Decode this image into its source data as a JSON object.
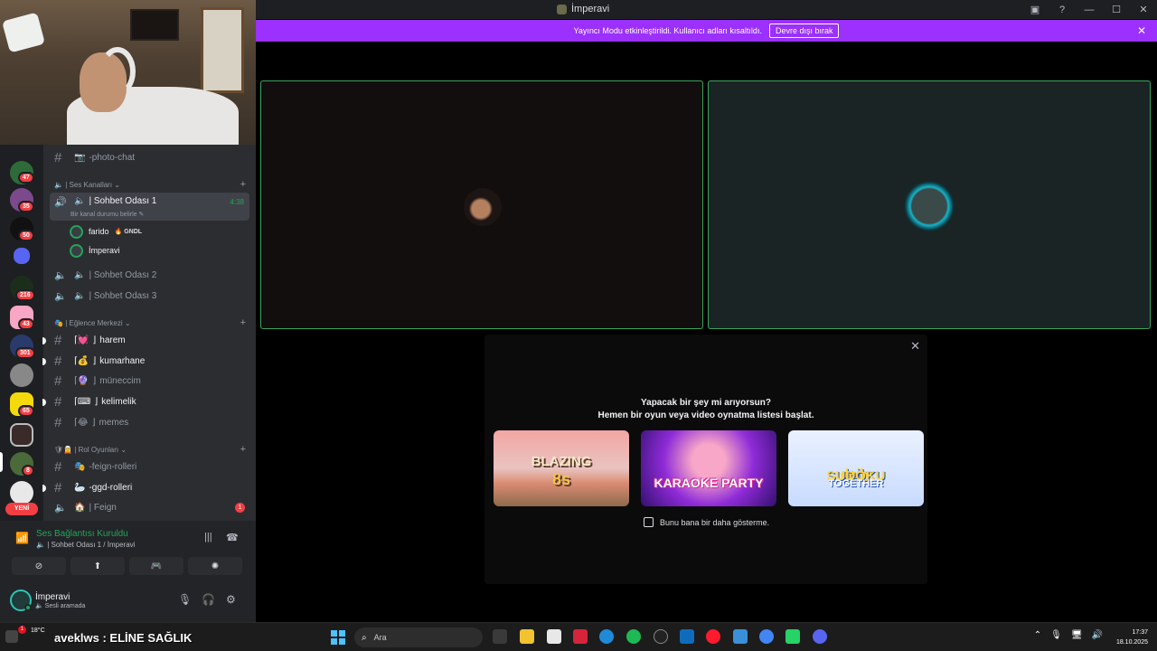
{
  "window": {
    "title": "İmperavi",
    "controls": [
      "minimize-icon",
      "maximize-icon",
      "close-icon"
    ]
  },
  "banner": {
    "message": "Yayıncı Modu etkinleştirildi. Kullanıcı adları kısaltıldı.",
    "button": "Devre dışı bırak",
    "close": "✕"
  },
  "guilds": {
    "badges": [
      "38",
      "47",
      "35",
      "50",
      "216",
      "43",
      "301",
      "65",
      "8"
    ],
    "new_label": "YENİ"
  },
  "channels": {
    "photo_chat": "-photo-chat",
    "voice_category": "| Ses Kanalları",
    "voice": [
      {
        "name": "| Sohbet Odası 1",
        "time": "4:38",
        "status_placeholder": "Bir kanal durumu belirle"
      },
      {
        "name": "| Sohbet Odası 2"
      },
      {
        "name": "| Sohbet Odası 3"
      }
    ],
    "voice_users": [
      {
        "name": "farido",
        "tag": "GNDL"
      },
      {
        "name": "İmperavi"
      }
    ],
    "fun_category": "| Eğlence Merkezi",
    "fun": [
      {
        "emoji": "💓",
        "name": "harem"
      },
      {
        "emoji": "💰",
        "name": "kumarhane"
      },
      {
        "emoji": "🔮",
        "name": "müneccim"
      },
      {
        "emoji": "⌨",
        "name": "kelimelik"
      },
      {
        "emoji": "😂",
        "name": "memes"
      }
    ],
    "bracket_open": "⌈",
    "bracket_close": "⌋",
    "rp_category": "| Rol Oyunları",
    "rp": [
      {
        "name": "-feign-rolleri"
      },
      {
        "name": "-ggd-rolleri"
      },
      {
        "name": "| Feign",
        "badge": "1"
      }
    ]
  },
  "voice_panel": {
    "status": "Ses Bağlantısı Kuruldu",
    "location": "| Sohbet Odası 1 / İmperavi",
    "user": "İmperavi",
    "user_status": "Sesli aramada"
  },
  "activity": {
    "line1": "Yapacak bir şey mi arıyorsun?",
    "line2": "Hemen bir oyun veya video oynatma listesi başlat.",
    "cards": [
      {
        "title": "BLAZING",
        "title2": "8s"
      },
      {
        "title": "KARAOKE PARTY"
      },
      {
        "pre": "daily",
        "title": "SUDOKU",
        "post": "TOGETHER"
      }
    ],
    "checkbox": "Bunu bana bir daha gösterme."
  },
  "taskbar": {
    "weather": "18°C",
    "warn_badge": "1",
    "overlay_text": "aveklws : ELİNE SAĞLIK",
    "search_placeholder": "Ara",
    "time": "17:37",
    "date": "18.10.2025"
  },
  "colors": {
    "accent": "#9b30ff",
    "online": "#23a55a",
    "danger": "#f23f43",
    "sidebar": "#2b2d31",
    "guildbar": "#1e1f22"
  }
}
